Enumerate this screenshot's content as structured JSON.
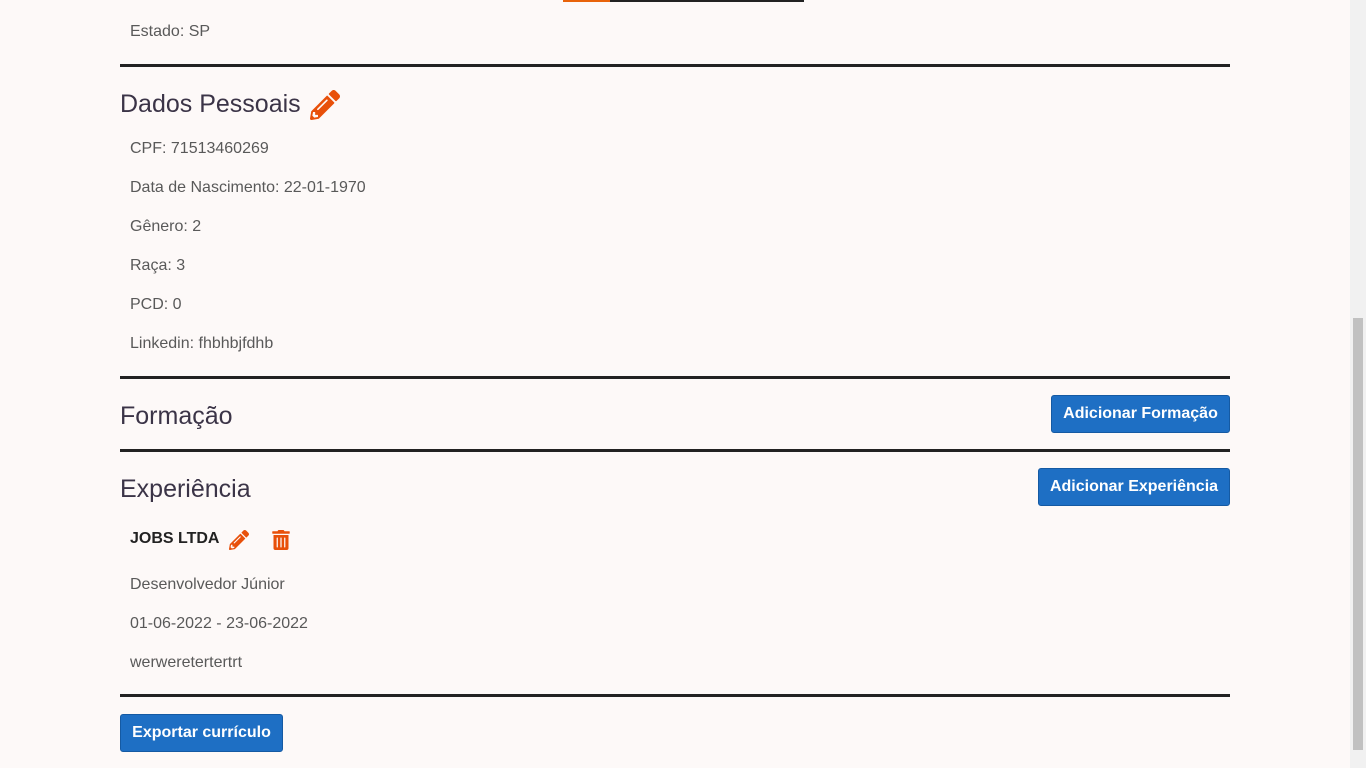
{
  "address": {
    "state_line": "Estado: SP"
  },
  "personal": {
    "title": "Dados Pessoais",
    "fields": [
      "CPF: 71513460269",
      "Data de Nascimento: 22-01-1970",
      "Gênero: 2",
      "Raça: 3",
      "PCD: 0",
      "Linkedin: fhbhbjfdhb"
    ]
  },
  "education": {
    "title": "Formação",
    "add_label": "Adicionar Formação"
  },
  "experience": {
    "title": "Experiência",
    "add_label": "Adicionar Experiência",
    "items": [
      {
        "company": "JOBS LTDA",
        "role": "Desenvolvedor Júnior",
        "period": "01-06-2022 - 23-06-2022",
        "description": "werweretertertrt"
      }
    ]
  },
  "footer": {
    "export_label": "Exportar currículo"
  },
  "colors": {
    "accent": "#e8630a",
    "primary_button": "#1e6fc4",
    "divider": "#222222"
  },
  "icons": {
    "edit": "pencil-icon",
    "delete": "trash-icon"
  }
}
